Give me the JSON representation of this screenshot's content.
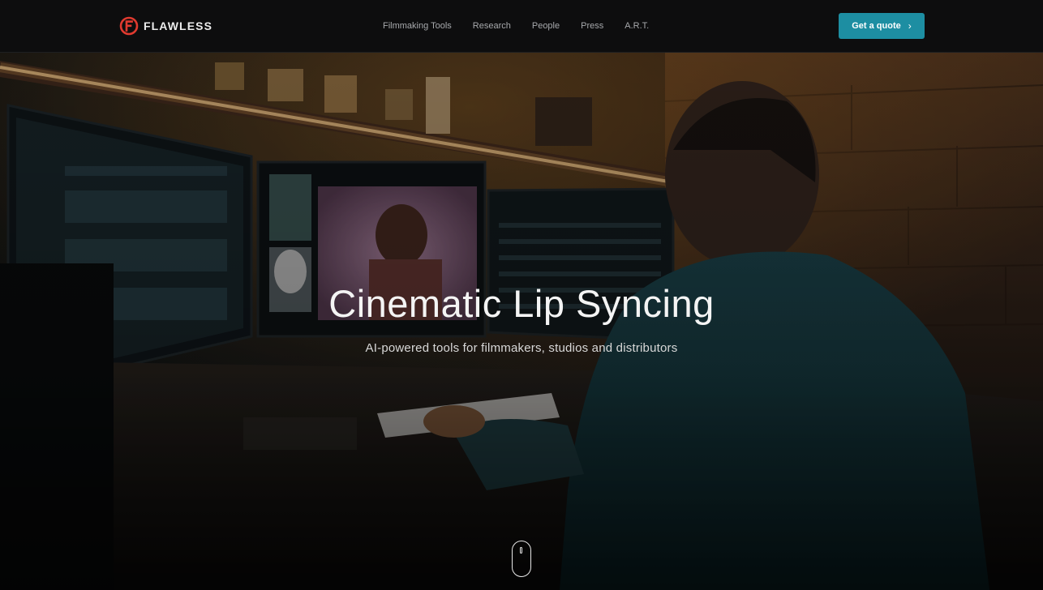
{
  "brand": {
    "name": "FLAWLESS",
    "logo_icon": "flawless-f-logo-icon",
    "accent": "#e03a2f"
  },
  "nav": {
    "items": [
      {
        "label": "Filmmaking Tools"
      },
      {
        "label": "Research"
      },
      {
        "label": "People"
      },
      {
        "label": "Press"
      },
      {
        "label": "A.R.T."
      }
    ]
  },
  "cta": {
    "label": "Get a quote",
    "icon": "chevron-right-icon",
    "color": "#1d8ea2"
  },
  "hero": {
    "title": "Cinematic Lip Syncing",
    "subtitle": "AI-powered tools for filmmakers, studios and distributors",
    "scroll_icon": "mouse-scroll-icon"
  }
}
